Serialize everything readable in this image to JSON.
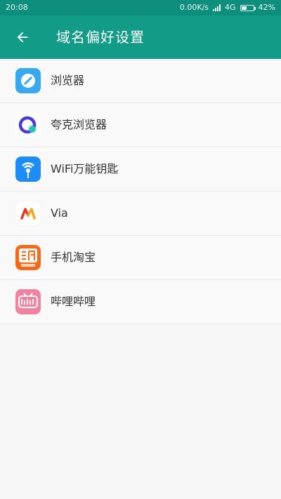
{
  "status_bar": {
    "time": "20:08",
    "speed": "0.00K/s",
    "network": "4G",
    "battery": "42%",
    "battery_level": 0.42
  },
  "header": {
    "title": "域名偏好设置",
    "back_icon": "arrow-left-icon"
  },
  "apps": [
    {
      "label": "浏览器",
      "icon": "browser-icon"
    },
    {
      "label": "夸克浏览器",
      "icon": "quark-icon"
    },
    {
      "label": "WiFi万能钥匙",
      "icon": "wifi-key-icon"
    },
    {
      "label": "Via",
      "icon": "via-icon"
    },
    {
      "label": "手机淘宝",
      "icon": "taobao-icon"
    },
    {
      "label": "哔哩哔哩",
      "icon": "bilibili-icon"
    }
  ],
  "colors": {
    "primary": "#129b87",
    "status_bar": "#0e8f7e",
    "background": "#f7f7f7"
  }
}
